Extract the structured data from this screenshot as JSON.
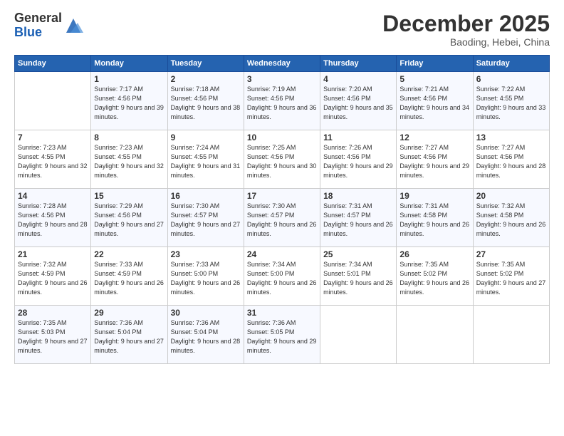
{
  "logo": {
    "general": "General",
    "blue": "Blue"
  },
  "title": "December 2025",
  "location": "Baoding, Hebei, China",
  "days_of_week": [
    "Sunday",
    "Monday",
    "Tuesday",
    "Wednesday",
    "Thursday",
    "Friday",
    "Saturday"
  ],
  "weeks": [
    [
      {
        "day": "",
        "sunrise": "",
        "sunset": "",
        "daylight": ""
      },
      {
        "day": "1",
        "sunrise": "Sunrise: 7:17 AM",
        "sunset": "Sunset: 4:56 PM",
        "daylight": "Daylight: 9 hours and 39 minutes."
      },
      {
        "day": "2",
        "sunrise": "Sunrise: 7:18 AM",
        "sunset": "Sunset: 4:56 PM",
        "daylight": "Daylight: 9 hours and 38 minutes."
      },
      {
        "day": "3",
        "sunrise": "Sunrise: 7:19 AM",
        "sunset": "Sunset: 4:56 PM",
        "daylight": "Daylight: 9 hours and 36 minutes."
      },
      {
        "day": "4",
        "sunrise": "Sunrise: 7:20 AM",
        "sunset": "Sunset: 4:56 PM",
        "daylight": "Daylight: 9 hours and 35 minutes."
      },
      {
        "day": "5",
        "sunrise": "Sunrise: 7:21 AM",
        "sunset": "Sunset: 4:56 PM",
        "daylight": "Daylight: 9 hours and 34 minutes."
      },
      {
        "day": "6",
        "sunrise": "Sunrise: 7:22 AM",
        "sunset": "Sunset: 4:55 PM",
        "daylight": "Daylight: 9 hours and 33 minutes."
      }
    ],
    [
      {
        "day": "7",
        "sunrise": "Sunrise: 7:23 AM",
        "sunset": "Sunset: 4:55 PM",
        "daylight": "Daylight: 9 hours and 32 minutes."
      },
      {
        "day": "8",
        "sunrise": "Sunrise: 7:23 AM",
        "sunset": "Sunset: 4:55 PM",
        "daylight": "Daylight: 9 hours and 32 minutes."
      },
      {
        "day": "9",
        "sunrise": "Sunrise: 7:24 AM",
        "sunset": "Sunset: 4:55 PM",
        "daylight": "Daylight: 9 hours and 31 minutes."
      },
      {
        "day": "10",
        "sunrise": "Sunrise: 7:25 AM",
        "sunset": "Sunset: 4:56 PM",
        "daylight": "Daylight: 9 hours and 30 minutes."
      },
      {
        "day": "11",
        "sunrise": "Sunrise: 7:26 AM",
        "sunset": "Sunset: 4:56 PM",
        "daylight": "Daylight: 9 hours and 29 minutes."
      },
      {
        "day": "12",
        "sunrise": "Sunrise: 7:27 AM",
        "sunset": "Sunset: 4:56 PM",
        "daylight": "Daylight: 9 hours and 29 minutes."
      },
      {
        "day": "13",
        "sunrise": "Sunrise: 7:27 AM",
        "sunset": "Sunset: 4:56 PM",
        "daylight": "Daylight: 9 hours and 28 minutes."
      }
    ],
    [
      {
        "day": "14",
        "sunrise": "Sunrise: 7:28 AM",
        "sunset": "Sunset: 4:56 PM",
        "daylight": "Daylight: 9 hours and 28 minutes."
      },
      {
        "day": "15",
        "sunrise": "Sunrise: 7:29 AM",
        "sunset": "Sunset: 4:56 PM",
        "daylight": "Daylight: 9 hours and 27 minutes."
      },
      {
        "day": "16",
        "sunrise": "Sunrise: 7:30 AM",
        "sunset": "Sunset: 4:57 PM",
        "daylight": "Daylight: 9 hours and 27 minutes."
      },
      {
        "day": "17",
        "sunrise": "Sunrise: 7:30 AM",
        "sunset": "Sunset: 4:57 PM",
        "daylight": "Daylight: 9 hours and 26 minutes."
      },
      {
        "day": "18",
        "sunrise": "Sunrise: 7:31 AM",
        "sunset": "Sunset: 4:57 PM",
        "daylight": "Daylight: 9 hours and 26 minutes."
      },
      {
        "day": "19",
        "sunrise": "Sunrise: 7:31 AM",
        "sunset": "Sunset: 4:58 PM",
        "daylight": "Daylight: 9 hours and 26 minutes."
      },
      {
        "day": "20",
        "sunrise": "Sunrise: 7:32 AM",
        "sunset": "Sunset: 4:58 PM",
        "daylight": "Daylight: 9 hours and 26 minutes."
      }
    ],
    [
      {
        "day": "21",
        "sunrise": "Sunrise: 7:32 AM",
        "sunset": "Sunset: 4:59 PM",
        "daylight": "Daylight: 9 hours and 26 minutes."
      },
      {
        "day": "22",
        "sunrise": "Sunrise: 7:33 AM",
        "sunset": "Sunset: 4:59 PM",
        "daylight": "Daylight: 9 hours and 26 minutes."
      },
      {
        "day": "23",
        "sunrise": "Sunrise: 7:33 AM",
        "sunset": "Sunset: 5:00 PM",
        "daylight": "Daylight: 9 hours and 26 minutes."
      },
      {
        "day": "24",
        "sunrise": "Sunrise: 7:34 AM",
        "sunset": "Sunset: 5:00 PM",
        "daylight": "Daylight: 9 hours and 26 minutes."
      },
      {
        "day": "25",
        "sunrise": "Sunrise: 7:34 AM",
        "sunset": "Sunset: 5:01 PM",
        "daylight": "Daylight: 9 hours and 26 minutes."
      },
      {
        "day": "26",
        "sunrise": "Sunrise: 7:35 AM",
        "sunset": "Sunset: 5:02 PM",
        "daylight": "Daylight: 9 hours and 26 minutes."
      },
      {
        "day": "27",
        "sunrise": "Sunrise: 7:35 AM",
        "sunset": "Sunset: 5:02 PM",
        "daylight": "Daylight: 9 hours and 27 minutes."
      }
    ],
    [
      {
        "day": "28",
        "sunrise": "Sunrise: 7:35 AM",
        "sunset": "Sunset: 5:03 PM",
        "daylight": "Daylight: 9 hours and 27 minutes."
      },
      {
        "day": "29",
        "sunrise": "Sunrise: 7:36 AM",
        "sunset": "Sunset: 5:04 PM",
        "daylight": "Daylight: 9 hours and 27 minutes."
      },
      {
        "day": "30",
        "sunrise": "Sunrise: 7:36 AM",
        "sunset": "Sunset: 5:04 PM",
        "daylight": "Daylight: 9 hours and 28 minutes."
      },
      {
        "day": "31",
        "sunrise": "Sunrise: 7:36 AM",
        "sunset": "Sunset: 5:05 PM",
        "daylight": "Daylight: 9 hours and 29 minutes."
      },
      {
        "day": "",
        "sunrise": "",
        "sunset": "",
        "daylight": ""
      },
      {
        "day": "",
        "sunrise": "",
        "sunset": "",
        "daylight": ""
      },
      {
        "day": "",
        "sunrise": "",
        "sunset": "",
        "daylight": ""
      }
    ]
  ]
}
